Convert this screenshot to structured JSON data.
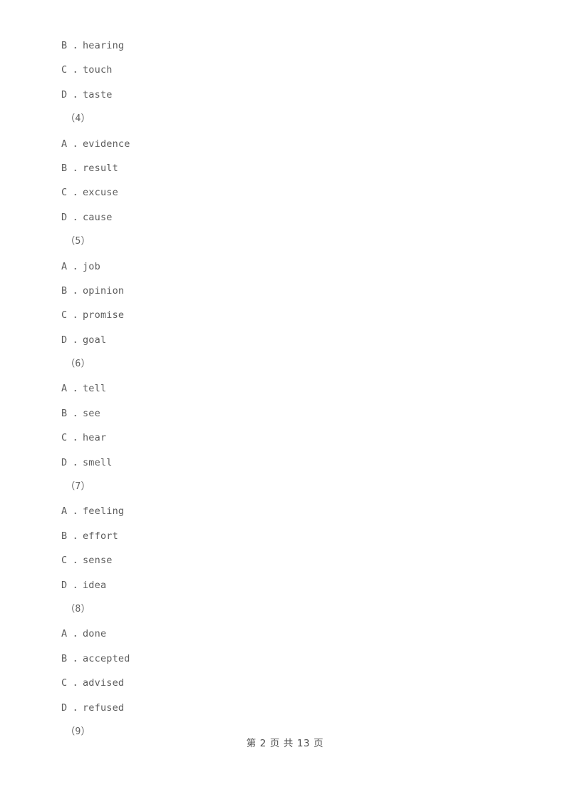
{
  "document": {
    "page_footer": "第 2 页 共 13 页",
    "page_number": "2",
    "total_pages": "13",
    "text_color": "#5c5c5c",
    "background_color": "#ffffff"
  },
  "lines": [
    {
      "kind": "option",
      "letter": "B",
      "sep": " ．",
      "text": "hearing"
    },
    {
      "kind": "option",
      "letter": "C",
      "sep": " ．",
      "text": "touch"
    },
    {
      "kind": "option",
      "letter": "D",
      "sep": " ．",
      "text": "taste"
    },
    {
      "kind": "group",
      "label": "（4）"
    },
    {
      "kind": "option",
      "letter": "A",
      "sep": " ．",
      "text": "evidence"
    },
    {
      "kind": "option",
      "letter": "B",
      "sep": " ．",
      "text": "result"
    },
    {
      "kind": "option",
      "letter": "C",
      "sep": " ．",
      "text": "excuse"
    },
    {
      "kind": "option",
      "letter": "D",
      "sep": " ．",
      "text": "cause"
    },
    {
      "kind": "group",
      "label": "（5）"
    },
    {
      "kind": "option",
      "letter": "A",
      "sep": " ．",
      "text": "job"
    },
    {
      "kind": "option",
      "letter": "B",
      "sep": " ．",
      "text": "opinion"
    },
    {
      "kind": "option",
      "letter": "C",
      "sep": " ．",
      "text": "promise"
    },
    {
      "kind": "option",
      "letter": "D",
      "sep": " ．",
      "text": "goal"
    },
    {
      "kind": "group",
      "label": "（6）"
    },
    {
      "kind": "option",
      "letter": "A",
      "sep": " ．",
      "text": "tell"
    },
    {
      "kind": "option",
      "letter": "B",
      "sep": " ．",
      "text": "see"
    },
    {
      "kind": "option",
      "letter": "C",
      "sep": " ．",
      "text": "hear"
    },
    {
      "kind": "option",
      "letter": "D",
      "sep": " ．",
      "text": "smell"
    },
    {
      "kind": "group",
      "label": "（7）"
    },
    {
      "kind": "option",
      "letter": "A",
      "sep": " ．",
      "text": "feeling"
    },
    {
      "kind": "option",
      "letter": "B",
      "sep": " ．",
      "text": "effort"
    },
    {
      "kind": "option",
      "letter": "C",
      "sep": " ．",
      "text": "sense"
    },
    {
      "kind": "option",
      "letter": "D",
      "sep": " ．",
      "text": "idea"
    },
    {
      "kind": "group",
      "label": "（8）"
    },
    {
      "kind": "option",
      "letter": "A",
      "sep": " ．",
      "text": "done"
    },
    {
      "kind": "option",
      "letter": "B",
      "sep": " ．",
      "text": "accepted"
    },
    {
      "kind": "option",
      "letter": "C",
      "sep": " ．",
      "text": "advised"
    },
    {
      "kind": "option",
      "letter": "D",
      "sep": " ．",
      "text": "refused"
    },
    {
      "kind": "group",
      "label": "（9）"
    }
  ]
}
